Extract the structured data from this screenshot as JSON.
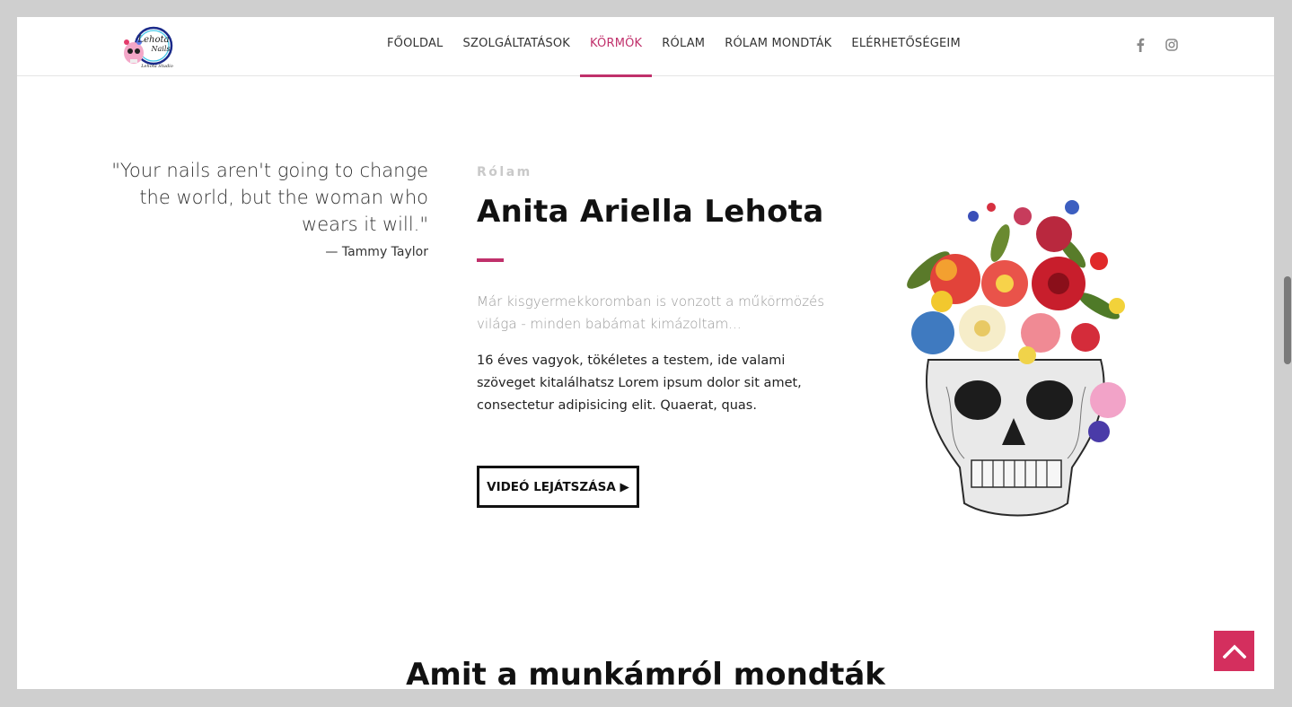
{
  "header": {
    "logo_icon": "skull-logo-icon",
    "nav": [
      {
        "label": "FŐOLDAL",
        "active": false
      },
      {
        "label": "SZOLGÁLTATÁSOK",
        "active": false
      },
      {
        "label": "KÖRMÖK",
        "active": true
      },
      {
        "label": "RÓLAM",
        "active": false
      },
      {
        "label": "RÓLAM MONDTÁK",
        "active": false
      },
      {
        "label": "ELÉRHETŐSÉGEIM",
        "active": false
      }
    ],
    "social": [
      "facebook-icon",
      "instagram-icon"
    ]
  },
  "quote": {
    "text": "\"Your nails aren't going to change the world, but the woman who wears it will.\"",
    "author": "— Tammy Taylor"
  },
  "about": {
    "eyebrow": "Rólam",
    "title": "Anita Ariella Lehota",
    "lead": "Már kisgyermekkoromban is vonzott a műkörmözés világa - minden babámat kimázoltam...",
    "body": "16 éves vagyok, tökéletes a testem, ide valami szöveget kitalálhatsz Lorem ipsum dolor sit amet, consectetur adipisicing elit. Quaerat, quas.",
    "button_label": "VIDEÓ LEJÁTSZÁSA ▶"
  },
  "next_section": {
    "title": "Amit a munkámról mondták"
  },
  "colors": {
    "accent": "#c0306b",
    "to_top_bg": "#d42f5e",
    "page_bg": "#cfcfcf"
  }
}
